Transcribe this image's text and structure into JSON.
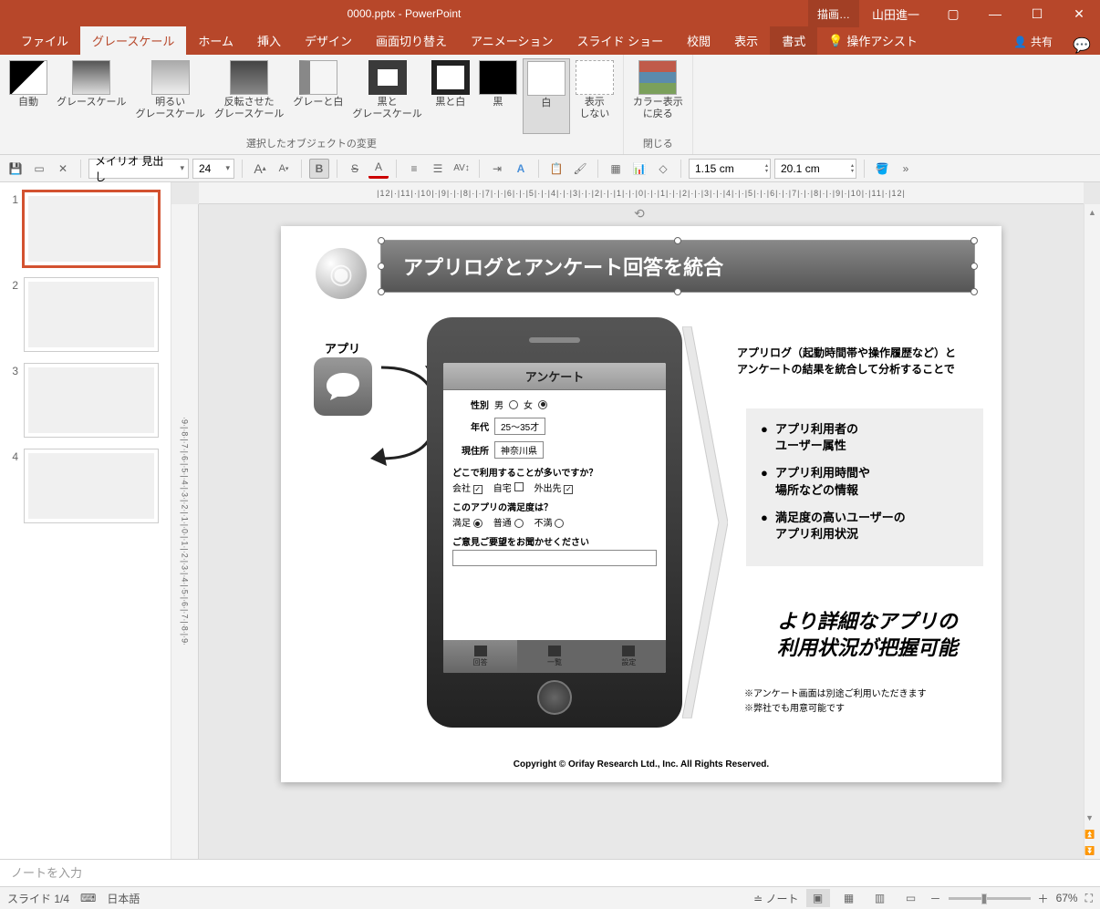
{
  "titlebar": {
    "title": "0000.pptx - PowerPoint",
    "draw": "描画…",
    "user": "山田進一"
  },
  "tabs": {
    "file": "ファイル",
    "grayscale": "グレースケール",
    "home": "ホーム",
    "insert": "挿入",
    "design": "デザイン",
    "transitions": "画面切り替え",
    "animations": "アニメーション",
    "slideshow": "スライド ショー",
    "review": "校閲",
    "view": "表示",
    "format": "書式",
    "tell": "操作アシスト",
    "share": "共有"
  },
  "ribbon": {
    "auto": "自動",
    "grayscale": "グレースケール",
    "light": "明るい\nグレースケール",
    "inverse": "反転させた\nグレースケール",
    "graywhite": "グレーと白",
    "blackgray": "黒と\nグレースケール",
    "blackwhite": "黒と白",
    "black": "黒",
    "white": "白",
    "dontshow": "表示\nしない",
    "group1": "選択したオブジェクトの変更",
    "backcolor": "カラー表示\nに戻る",
    "group2": "閉じる"
  },
  "qat": {
    "font": "メイリオ 見出し",
    "size": "24",
    "height": "1.15 cm",
    "width": "20.1 cm"
  },
  "slide": {
    "title": "アプリログとアンケート回答を統合",
    "app_label": "アプリ",
    "survey_title": "アンケート",
    "form": {
      "gender_label": "性別",
      "gender_m": "男",
      "gender_f": "女",
      "age_label": "年代",
      "age_val": "25～35才",
      "addr_label": "現住所",
      "addr_val": "神奈川県",
      "q1": "どこで利用することが多いですか？",
      "opt_office": "会社",
      "opt_home": "自宅",
      "opt_out": "外出先",
      "q2": "このアプリの満足度は？",
      "opt_sat": "満足",
      "opt_norm": "普通",
      "opt_unsat": "不満",
      "q3": "ご意見ご要望をお聞かせください",
      "tab1": "回答",
      "tab2": "一覧",
      "tab3": "設定"
    },
    "desc": "アプリログ（起動時間帯や操作履歴など）と\nアンケートの結果を統合して分析することで",
    "b1": "アプリ利用者の\nユーザー属性",
    "b2": "アプリ利用時間や\n場所などの情報",
    "b3": "満足度の高いユーザーの\nアプリ利用状況",
    "headline": "より詳細なアプリの\n利用状況が把握可能",
    "note1": "※アンケート画面は別途ご利用いただきます",
    "note2": "※弊社でも用意可能です",
    "copyright": "Copyright © Orifay Research Ltd., Inc. All Rights Reserved."
  },
  "notes": "ノートを入力",
  "status": {
    "slide": "スライド 1/4",
    "lang": "日本語",
    "notes": "ノート",
    "zoom": "67%"
  }
}
